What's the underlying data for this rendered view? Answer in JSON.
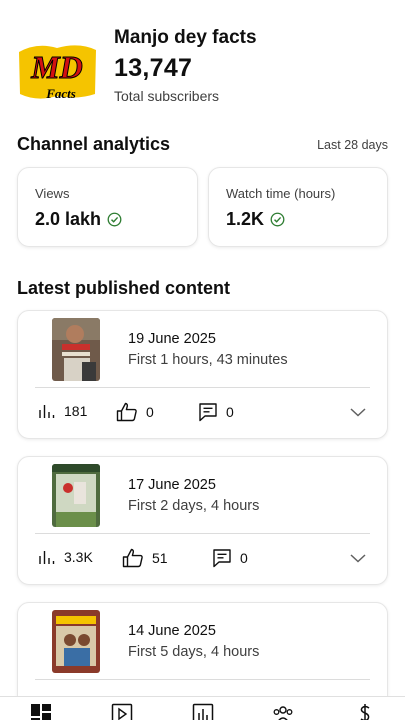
{
  "channel": {
    "logo_text": "MD",
    "logo_subtext": "Facts",
    "name": "Manjo dey facts",
    "subscribers": "13,747",
    "subscribers_label": "Total subscribers"
  },
  "analytics": {
    "title": "Channel analytics",
    "period": "Last 28 days",
    "cards": [
      {
        "label": "Views",
        "value": "2.0 lakh"
      },
      {
        "label": "Watch time (hours)",
        "value": "1.2K"
      }
    ]
  },
  "latest": {
    "title": "Latest published content",
    "items": [
      {
        "date": "19 June 2025",
        "subtitle": "First 1 hours, 43 minutes",
        "views": "181",
        "likes": "0",
        "comments": "0"
      },
      {
        "date": "17 June 2025",
        "subtitle": "First 2 days, 4 hours",
        "views": "3.3K",
        "likes": "51",
        "comments": "0"
      },
      {
        "date": "14 June 2025",
        "subtitle": "First 5 days, 4 hours"
      }
    ]
  },
  "colors": {
    "check_green": "#2e7d32",
    "logo_yellow": "#f5c400",
    "logo_red": "#d31111"
  },
  "nav": {
    "icons": [
      "dashboard-icon",
      "content-icon",
      "analytics-icon",
      "community-icon",
      "earn-icon"
    ]
  }
}
